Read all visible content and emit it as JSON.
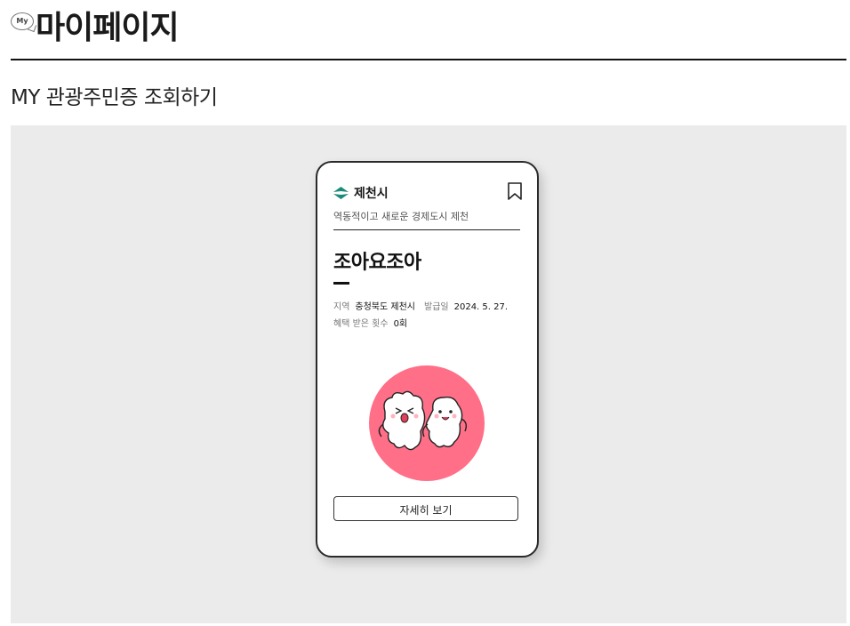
{
  "header": {
    "my_badge": "My",
    "title": "마이페이지"
  },
  "section": {
    "title": "MY 관광주민증 조회하기"
  },
  "card": {
    "city_name": "제천시",
    "slogan": "역동적이고 새로운 경제도시 제천",
    "nickname": "조아요조아",
    "region_label": "지역",
    "region_value": "충청북도 제천시",
    "issued_label": "발급일",
    "issued_value": "2024. 5. 27.",
    "benefit_label": "혜택 받은 횟수",
    "benefit_value": "0회",
    "detail_button": "자세히 보기",
    "colors": {
      "mascot_bg": "#ff6f88",
      "logo": "#1a8a7a"
    }
  }
}
